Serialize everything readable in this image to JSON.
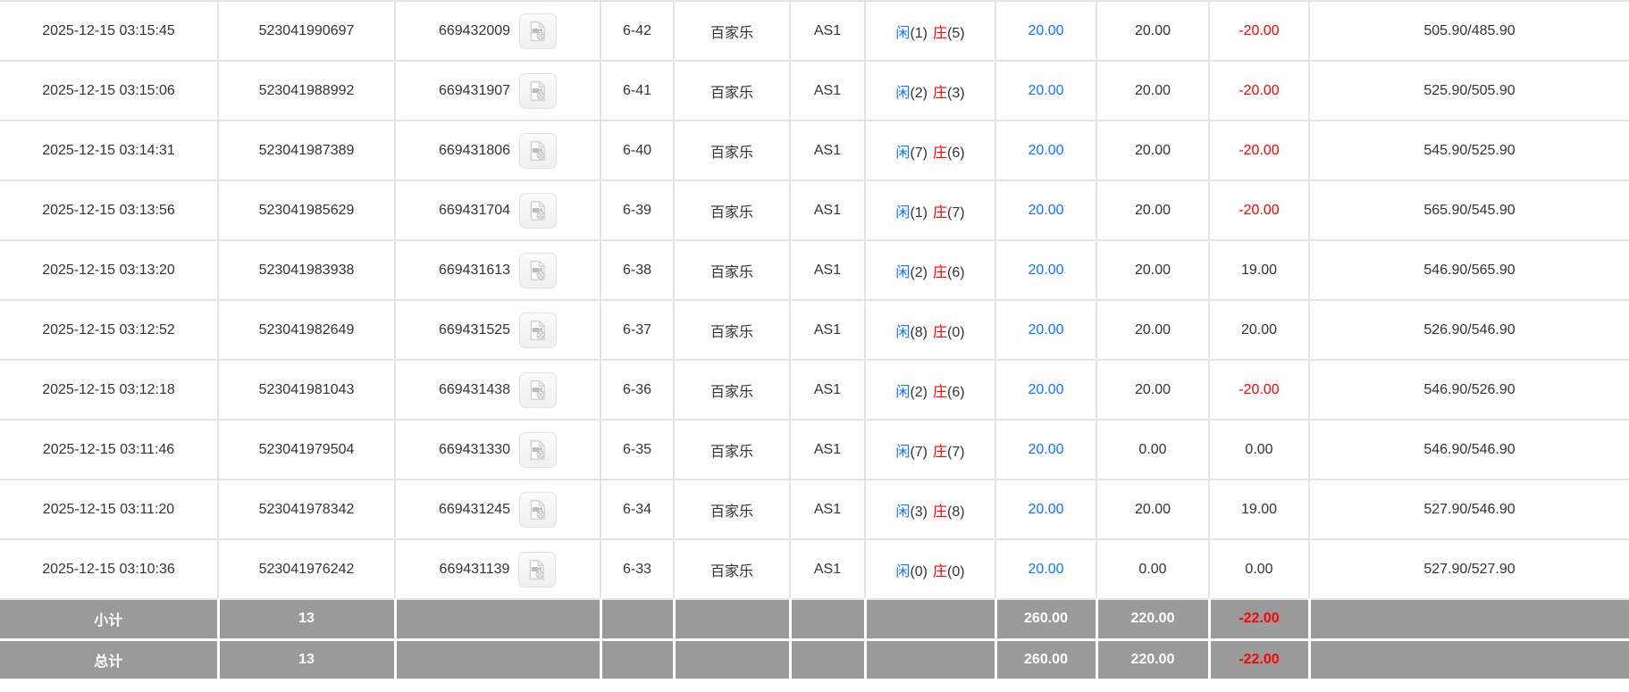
{
  "colors": {
    "link_blue": "#1673ff",
    "loss_red": "#ff0000",
    "player_blue": "#1673ff",
    "banker_red": "#ff0000",
    "summary_bg": "#9a9a9a",
    "row_border": "#e4e4e4",
    "text": "#333333"
  },
  "icons": {
    "video_replay": "video-replay-icon"
  },
  "table": {
    "rows": [
      {
        "time": "2025-12-15 03:15:45",
        "order_no": "523041990697",
        "game_no": "669432009",
        "round": "6-42",
        "game_type": "百家乐",
        "table_name": "AS1",
        "player_label": "闲",
        "player_score": "(1)",
        "banker_label": "庄",
        "banker_score": "(5)",
        "bet": "20.00",
        "valid_bet": "20.00",
        "win_loss": "-20.00",
        "balance": "505.90/485.90"
      },
      {
        "time": "2025-12-15 03:15:06",
        "order_no": "523041988992",
        "game_no": "669431907",
        "round": "6-41",
        "game_type": "百家乐",
        "table_name": "AS1",
        "player_label": "闲",
        "player_score": "(2)",
        "banker_label": "庄",
        "banker_score": "(3)",
        "bet": "20.00",
        "valid_bet": "20.00",
        "win_loss": "-20.00",
        "balance": "525.90/505.90"
      },
      {
        "time": "2025-12-15 03:14:31",
        "order_no": "523041987389",
        "game_no": "669431806",
        "round": "6-40",
        "game_type": "百家乐",
        "table_name": "AS1",
        "player_label": "闲",
        "player_score": "(7)",
        "banker_label": "庄",
        "banker_score": "(6)",
        "bet": "20.00",
        "valid_bet": "20.00",
        "win_loss": "-20.00",
        "balance": "545.90/525.90"
      },
      {
        "time": "2025-12-15 03:13:56",
        "order_no": "523041985629",
        "game_no": "669431704",
        "round": "6-39",
        "game_type": "百家乐",
        "table_name": "AS1",
        "player_label": "闲",
        "player_score": "(1)",
        "banker_label": "庄",
        "banker_score": "(7)",
        "bet": "20.00",
        "valid_bet": "20.00",
        "win_loss": "-20.00",
        "balance": "565.90/545.90"
      },
      {
        "time": "2025-12-15 03:13:20",
        "order_no": "523041983938",
        "game_no": "669431613",
        "round": "6-38",
        "game_type": "百家乐",
        "table_name": "AS1",
        "player_label": "闲",
        "player_score": "(2)",
        "banker_label": "庄",
        "banker_score": "(6)",
        "bet": "20.00",
        "valid_bet": "20.00",
        "win_loss": "19.00",
        "balance": "546.90/565.90"
      },
      {
        "time": "2025-12-15 03:12:52",
        "order_no": "523041982649",
        "game_no": "669431525",
        "round": "6-37",
        "game_type": "百家乐",
        "table_name": "AS1",
        "player_label": "闲",
        "player_score": "(8)",
        "banker_label": "庄",
        "banker_score": "(0)",
        "bet": "20.00",
        "valid_bet": "20.00",
        "win_loss": "20.00",
        "balance": "526.90/546.90"
      },
      {
        "time": "2025-12-15 03:12:18",
        "order_no": "523041981043",
        "game_no": "669431438",
        "round": "6-36",
        "game_type": "百家乐",
        "table_name": "AS1",
        "player_label": "闲",
        "player_score": "(2)",
        "banker_label": "庄",
        "banker_score": "(6)",
        "bet": "20.00",
        "valid_bet": "20.00",
        "win_loss": "-20.00",
        "balance": "546.90/526.90"
      },
      {
        "time": "2025-12-15 03:11:46",
        "order_no": "523041979504",
        "game_no": "669431330",
        "round": "6-35",
        "game_type": "百家乐",
        "table_name": "AS1",
        "player_label": "闲",
        "player_score": "(7)",
        "banker_label": "庄",
        "banker_score": "(7)",
        "bet": "20.00",
        "valid_bet": "0.00",
        "win_loss": "0.00",
        "balance": "546.90/546.90"
      },
      {
        "time": "2025-12-15 03:11:20",
        "order_no": "523041978342",
        "game_no": "669431245",
        "round": "6-34",
        "game_type": "百家乐",
        "table_name": "AS1",
        "player_label": "闲",
        "player_score": "(3)",
        "banker_label": "庄",
        "banker_score": "(8)",
        "bet": "20.00",
        "valid_bet": "20.00",
        "win_loss": "19.00",
        "balance": "527.90/546.90"
      },
      {
        "time": "2025-12-15 03:10:36",
        "order_no": "523041976242",
        "game_no": "669431139",
        "round": "6-33",
        "game_type": "百家乐",
        "table_name": "AS1",
        "player_label": "闲",
        "player_score": "(0)",
        "banker_label": "庄",
        "banker_score": "(0)",
        "bet": "20.00",
        "valid_bet": "0.00",
        "win_loss": "0.00",
        "balance": "527.90/527.90"
      }
    ],
    "subtotal": {
      "label": "小计",
      "count": "13",
      "bet": "260.00",
      "valid_bet": "220.00",
      "win_loss": "-22.00"
    },
    "total": {
      "label": "总计",
      "count": "13",
      "bet": "260.00",
      "valid_bet": "220.00",
      "win_loss": "-22.00"
    }
  }
}
